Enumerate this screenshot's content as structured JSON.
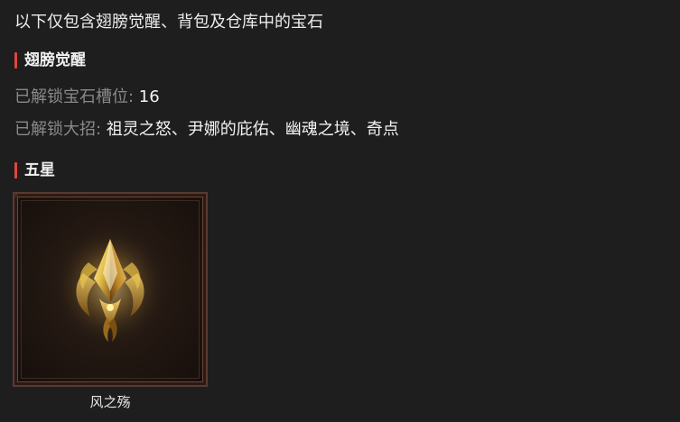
{
  "intro": "以下仅包含翅膀觉醒、背包及仓库中的宝石",
  "wing_section": {
    "title": "翅膀觉醒",
    "slots_label": "已解锁宝石槽位: ",
    "slots_value": "16",
    "skills_label": "已解锁大招: ",
    "skills_value": "祖灵之怒、尹娜的庇佑、幽魂之境、奇点"
  },
  "star_section": {
    "title": "五星",
    "gems": [
      {
        "name": "风之殇",
        "icon": "golden-crystal-gem-icon"
      }
    ]
  },
  "colors": {
    "accent_bar": "#e0463f",
    "background": "#1e1e1e",
    "gem_gold": "#e8c24a"
  }
}
